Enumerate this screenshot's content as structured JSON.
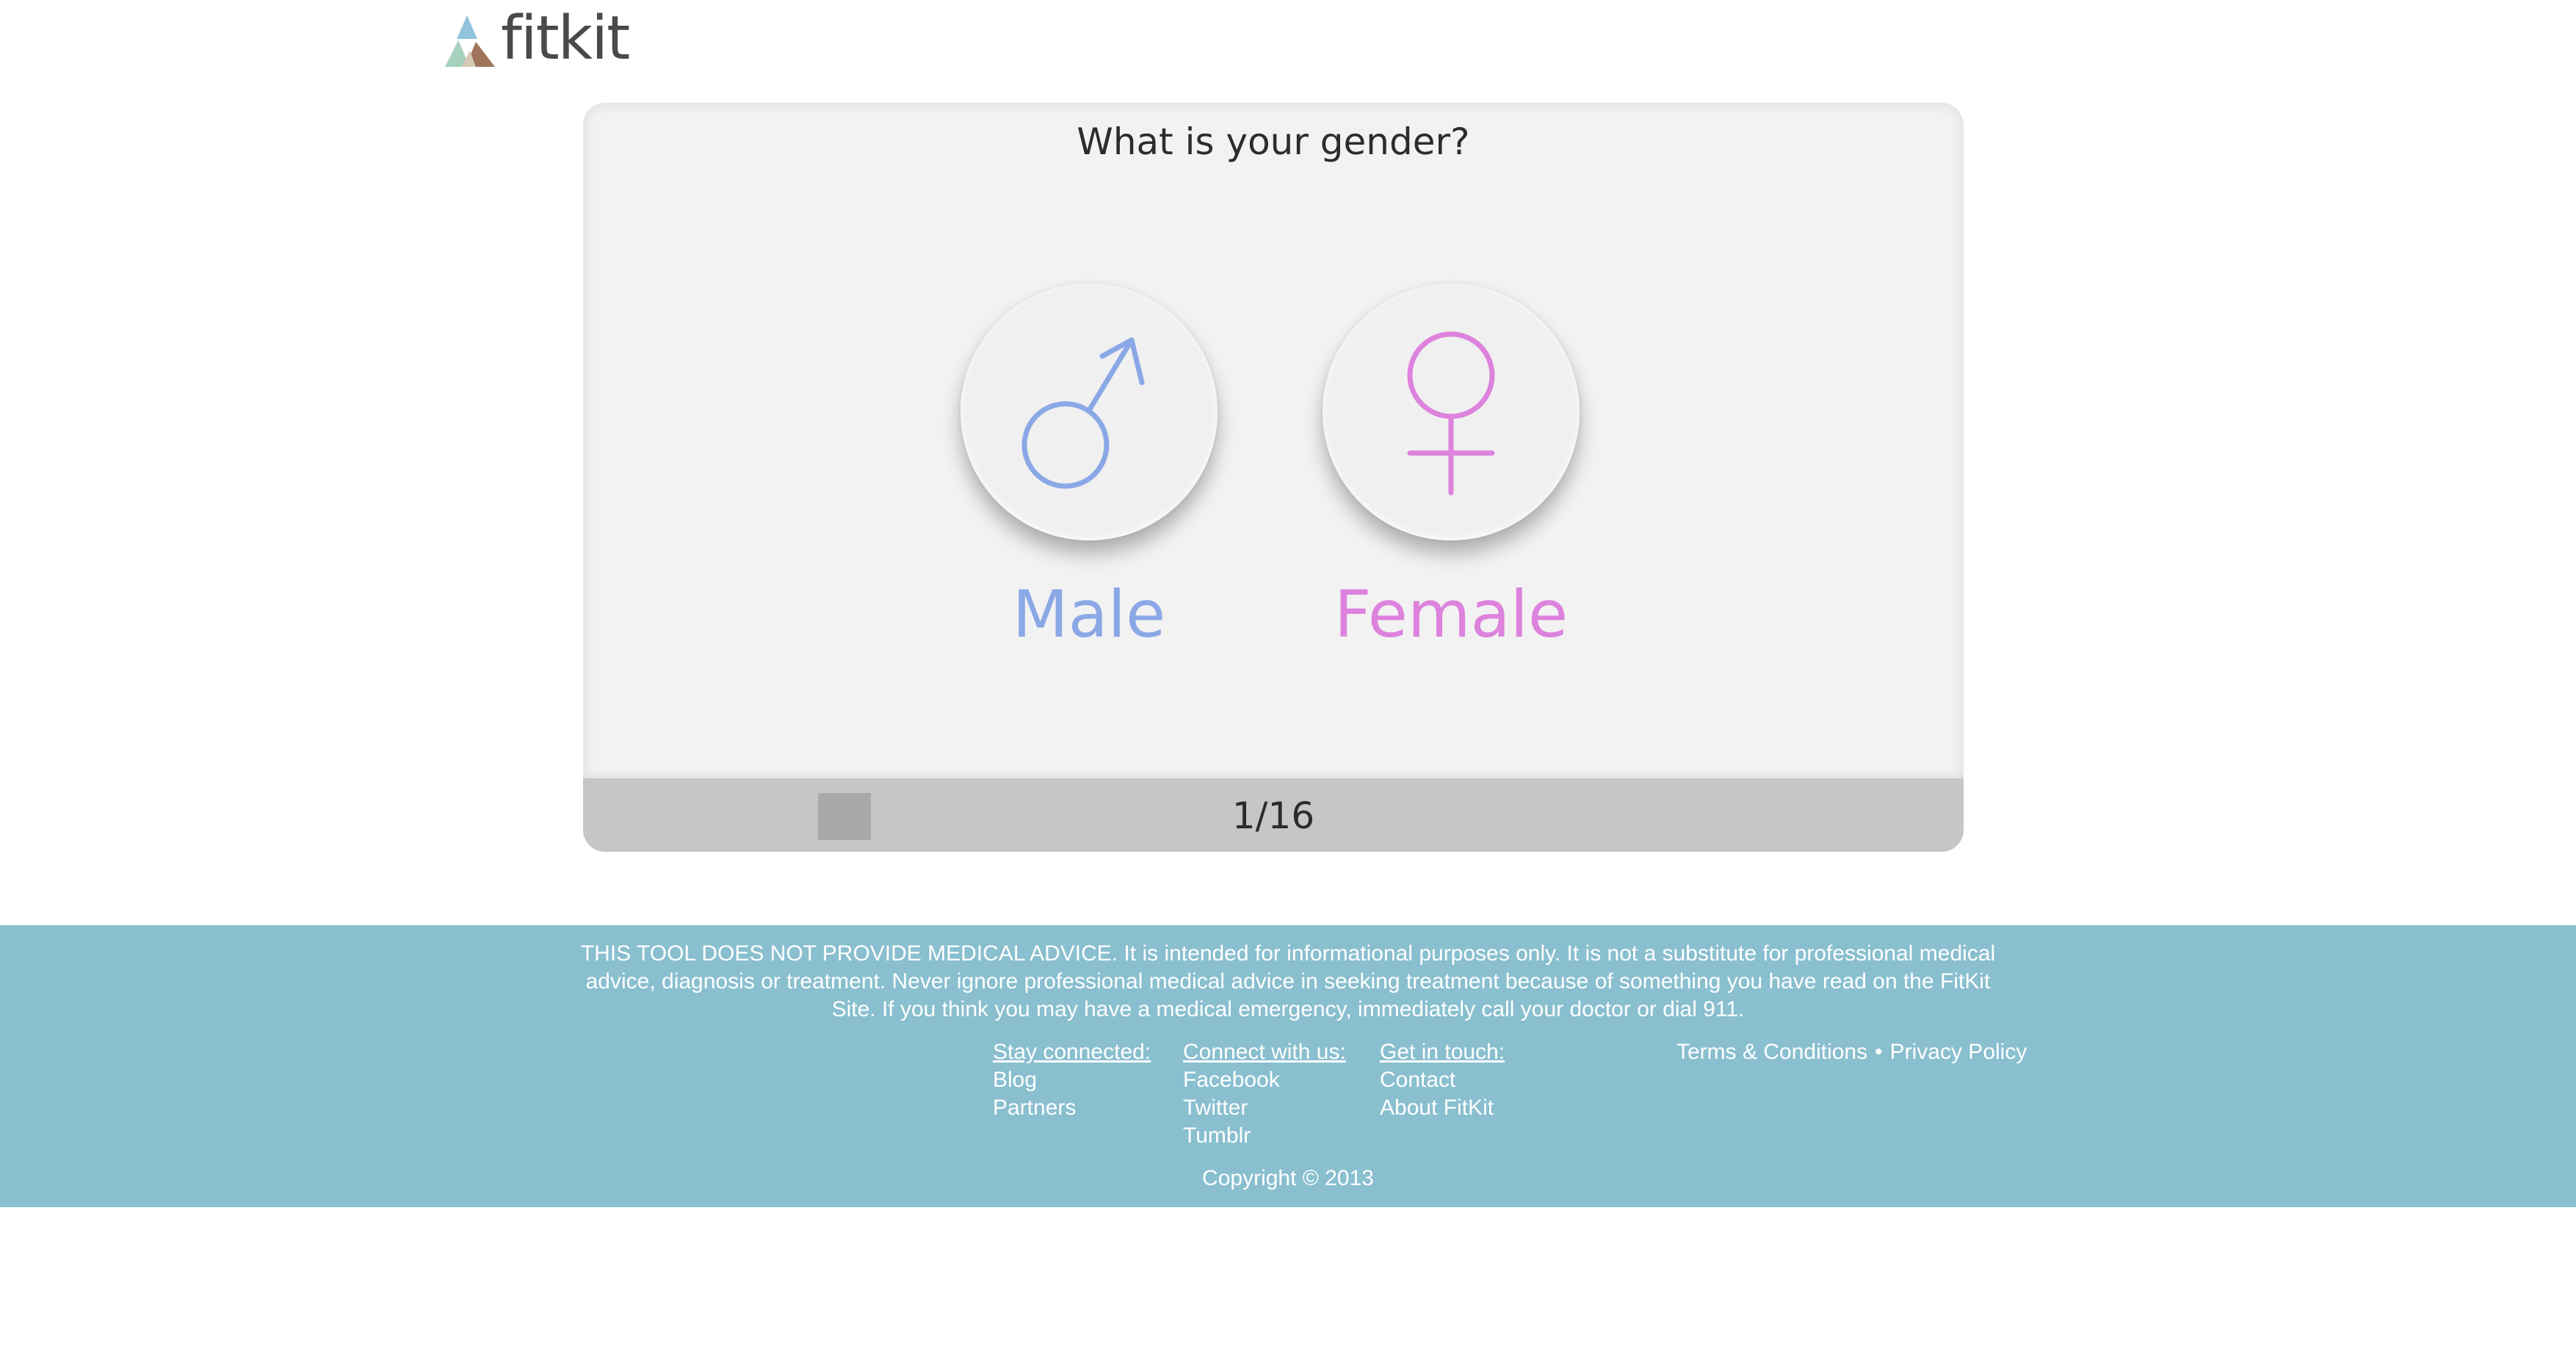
{
  "header": {
    "logo_text": "fitkit"
  },
  "quiz": {
    "question": "What is your gender?",
    "options": [
      {
        "label": "Male",
        "icon": "male-symbol-icon",
        "color": "#8aa8e6"
      },
      {
        "label": "Female",
        "icon": "female-symbol-icon",
        "color": "#dd82dd"
      }
    ],
    "progress": {
      "text": "1/16",
      "current": 1,
      "total": 16
    }
  },
  "footer": {
    "background_color": "#89bfcf",
    "disclaimer": "THIS TOOL DOES NOT PROVIDE MEDICAL ADVICE. It is intended for informational purposes only. It is not a substitute for professional medical advice, diagnosis or treatment. Never ignore professional medical advice in seeking treatment because of something you have read on the FitKit Site. If you think you may have a medical emergency, immediately call your doctor or dial 911.",
    "stay_connected": {
      "heading": "Stay connected:",
      "links": [
        "Blog",
        "Partners"
      ]
    },
    "connect_with_us": {
      "heading": "Connect with us:",
      "links": [
        "Facebook",
        "Twitter",
        "Tumblr"
      ]
    },
    "get_in_touch": {
      "heading": "Get in touch:",
      "links": [
        "Contact",
        "About FitKit"
      ]
    },
    "legal": {
      "terms": "Terms & Conditions",
      "separator": "•",
      "privacy": "Privacy Policy"
    },
    "copyright": "Copyright © 2013"
  }
}
